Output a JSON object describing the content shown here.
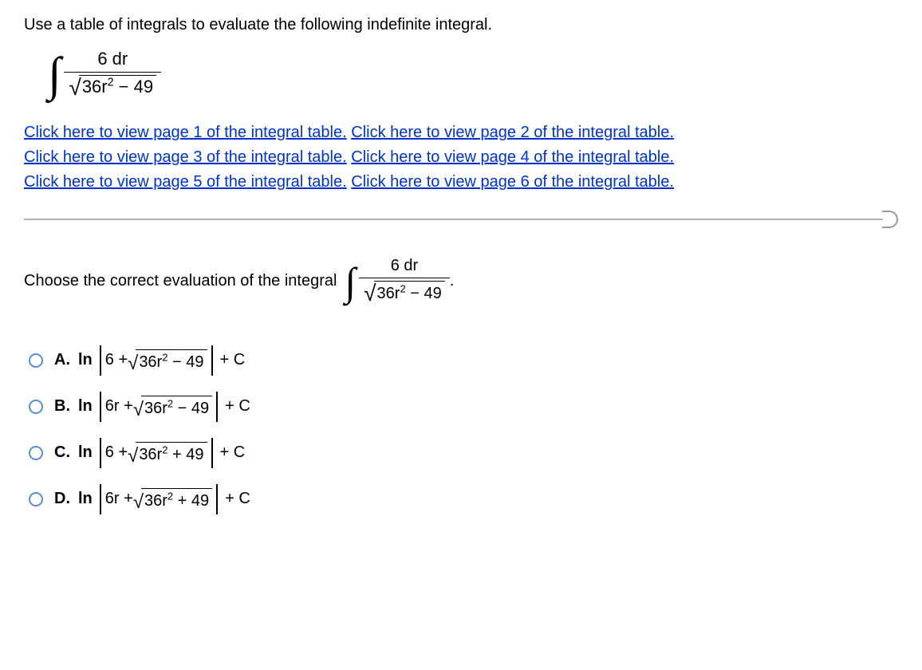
{
  "instruction": "Use a table of integrals to evaluate the following indefinite integral.",
  "integral": {
    "numerator": "6 dr",
    "denom_inside_sqrt_pre": "36r",
    "denom_inside_sqrt_exp": "2",
    "denom_inside_sqrt_post": " − 49"
  },
  "links": [
    "Click here to view page 1 of the integral table.",
    "Click here to view page 2 of the integral table.",
    "Click here to view page 3 of the integral table.",
    "Click here to view page 4 of the integral table.",
    "Click here to view page 5 of the integral table.",
    "Click here to view page 6 of the integral table."
  ],
  "choose_prefix": "Choose the correct evaluation of the integral ",
  "choose_suffix": ".",
  "options": [
    {
      "letter": "A.",
      "ln": "ln",
      "inner_pre": "6 + ",
      "sqrt_pre": "36r",
      "sqrt_exp": "2",
      "sqrt_post": " − 49",
      "plus_c": " + C"
    },
    {
      "letter": "B.",
      "ln": "ln",
      "inner_pre": "6r + ",
      "sqrt_pre": "36r",
      "sqrt_exp": "2",
      "sqrt_post": " − 49",
      "plus_c": " + C"
    },
    {
      "letter": "C.",
      "ln": "ln",
      "inner_pre": "6 + ",
      "sqrt_pre": "36r",
      "sqrt_exp": "2",
      "sqrt_post": " + 49",
      "plus_c": " + C"
    },
    {
      "letter": "D.",
      "ln": "ln",
      "inner_pre": "6r + ",
      "sqrt_pre": "36r",
      "sqrt_exp": "2",
      "sqrt_post": " + 49",
      "plus_c": " + C"
    }
  ]
}
